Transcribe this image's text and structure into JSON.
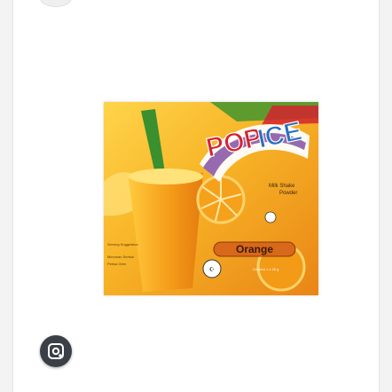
{
  "product": {
    "brand_line1": "POP",
    "brand_line2": "ICE",
    "flavor": "Orange",
    "small_texts": [
      "Milk Shake",
      "Powder",
      "Serving Suggestion",
      "Minuman Serbuk",
      "Perisa Oren",
      "Content 1 x 25 g"
    ]
  },
  "colors": {
    "orange": "#f39a16",
    "deep_orange": "#d8681a",
    "green": "#3a8f2f",
    "red": "#d4232f",
    "purple": "#6b2c91",
    "yellow": "#ffe02a"
  },
  "icons": {
    "lens": "image-search-icon"
  }
}
